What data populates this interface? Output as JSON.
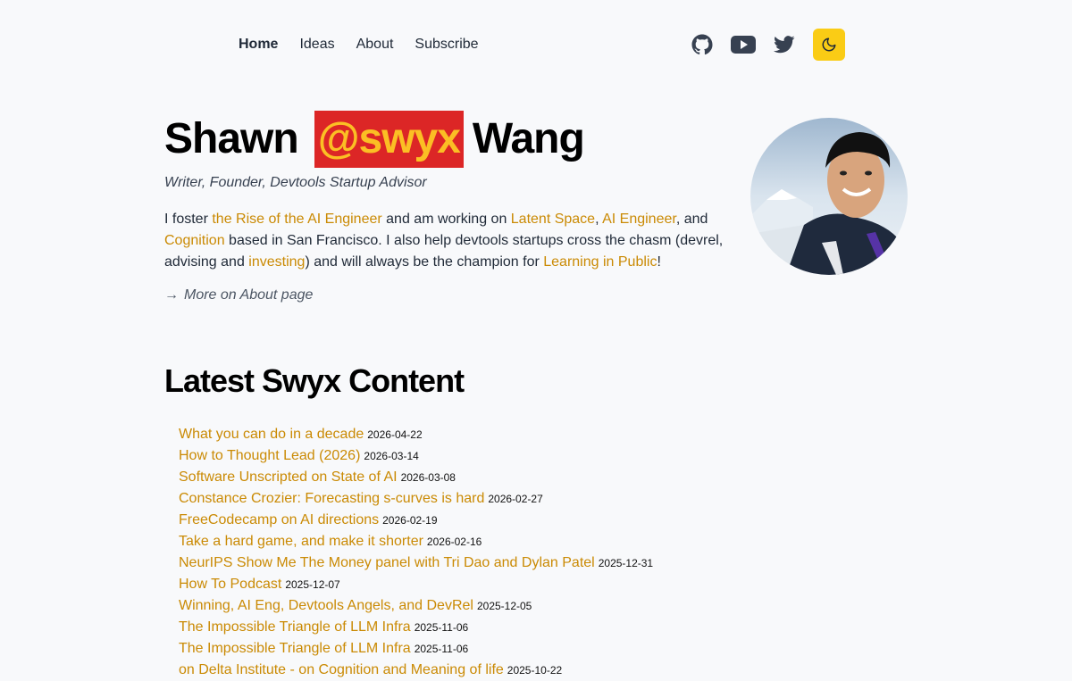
{
  "nav": {
    "links": [
      "Home",
      "Ideas",
      "About",
      "Subscribe"
    ],
    "icons": [
      "github-icon",
      "youtube-icon",
      "twitter-icon",
      "moon-icon"
    ]
  },
  "hero": {
    "first": "Shawn",
    "handle": "@swyx",
    "last": "Wang",
    "tagline": "Writer, Founder, Devtools Startup Advisor",
    "bio": {
      "t1": "I foster ",
      "l1": "the Rise of the AI Engineer",
      "t2": " and am working on ",
      "l2": "Latent Space",
      "t3": ", ",
      "l3": "AI Engineer",
      "t4": ", and ",
      "l4": "Cognition",
      "t5": " based in San Francisco. I also help devtools startups cross the chasm (devrel, advising and ",
      "l5": "investing",
      "t6": ") and will always be the champion for ",
      "l6": "Learning in Public",
      "t7": "!"
    },
    "more_arrow": "→",
    "more_label": "More on About page"
  },
  "latest": {
    "heading": "Latest Swyx Content",
    "posts": [
      {
        "title": "What you can do in a decade",
        "date": "2026-04-22"
      },
      {
        "title": "How to Thought Lead (2026)",
        "date": "2026-03-14"
      },
      {
        "title": "Software Unscripted on State of AI",
        "date": "2026-03-08"
      },
      {
        "title": "Constance Crozier: Forecasting s-curves is hard",
        "date": "2026-02-27"
      },
      {
        "title": "FreeCodecamp on AI directions",
        "date": "2026-02-19"
      },
      {
        "title": "Take a hard game, and make it shorter",
        "date": "2026-02-16"
      },
      {
        "title": "NeurIPS Show Me The Money panel with Tri Dao and Dylan Patel",
        "date": "2025-12-31"
      },
      {
        "title": "How To Podcast",
        "date": "2025-12-07"
      },
      {
        "title": "Winning, AI Eng, Devtools Angels, and DevRel",
        "date": "2025-12-05"
      },
      {
        "title": "The Impossible Triangle of LLM Infra",
        "date": "2025-11-06"
      },
      {
        "title": "The Impossible Triangle of LLM Infra",
        "date": "2025-11-06"
      },
      {
        "title": "on Delta Institute - on Cognition and Meaning of life",
        "date": "2025-10-22"
      }
    ]
  },
  "colors": {
    "link": "#ca8a04",
    "handle_bg": "#dc2626",
    "handle_text": "#fbbf24",
    "theme_button": "#facc15"
  }
}
